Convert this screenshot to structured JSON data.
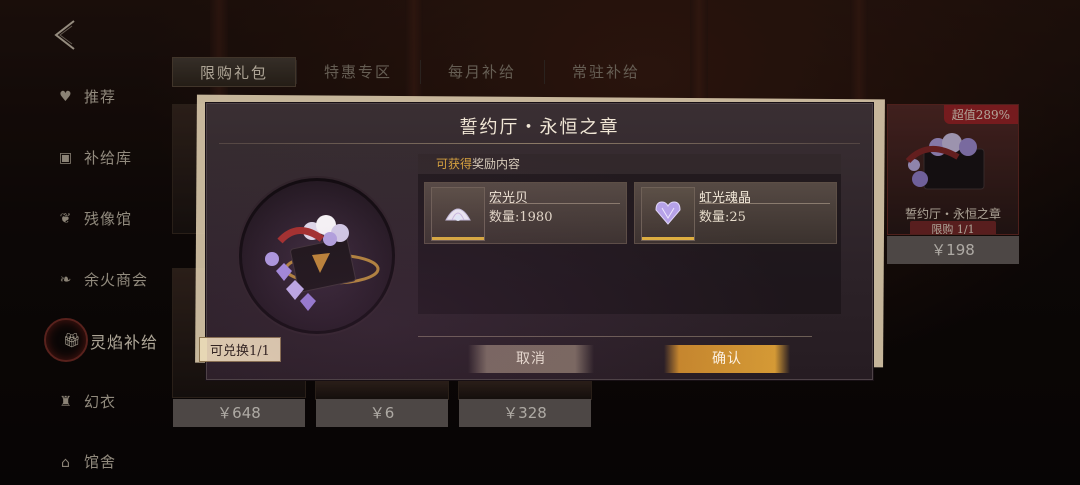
{
  "nav": {
    "back_icon": "back-arrow-icon",
    "items": [
      {
        "label": "推荐",
        "icon": "heart-icon",
        "active": false
      },
      {
        "label": "补给库",
        "icon": "box-icon",
        "active": false
      },
      {
        "label": "残像馆",
        "icon": "wing-icon",
        "active": false
      },
      {
        "label": "余火商会",
        "icon": "flame-icon",
        "active": false
      },
      {
        "label": "灵焰补给",
        "icon": "gift-icon",
        "active": true
      },
      {
        "label": "幻衣",
        "icon": "shirt-icon",
        "active": false
      },
      {
        "label": "馆舍",
        "icon": "house-icon",
        "active": false
      }
    ]
  },
  "tabs": [
    {
      "label": "限购礼包",
      "active": true
    },
    {
      "label": "特惠专区",
      "active": false
    },
    {
      "label": "每月补给",
      "active": false
    },
    {
      "label": "常驻补给",
      "active": false
    }
  ],
  "cards": {
    "prices": [
      "￥648",
      "￥6",
      "￥328"
    ],
    "right_card": {
      "badge": "超值289%",
      "name": "誓约厅・永恒之章",
      "limit": "限购 1/1",
      "price": "￥198"
    }
  },
  "modal": {
    "title": "誓约厅・永恒之章",
    "redeem_label": "可兑换1/1",
    "rewards_header_highlight": "可获得",
    "rewards_header_rest": "奖励内容",
    "rewards": [
      {
        "name": "宏光贝",
        "qty": "数量:1980",
        "icon": "shell-icon"
      },
      {
        "name": "虹光魂晶",
        "qty": "数量:25",
        "icon": "heart-crystal-icon"
      }
    ],
    "cancel_label": "取消",
    "confirm_label": "确认"
  },
  "colors": {
    "accent_gold": "#d6a23e",
    "confirm_button": "#c9892b",
    "cancel_button": "#7b6b60",
    "badge_red": "#a3262a"
  }
}
